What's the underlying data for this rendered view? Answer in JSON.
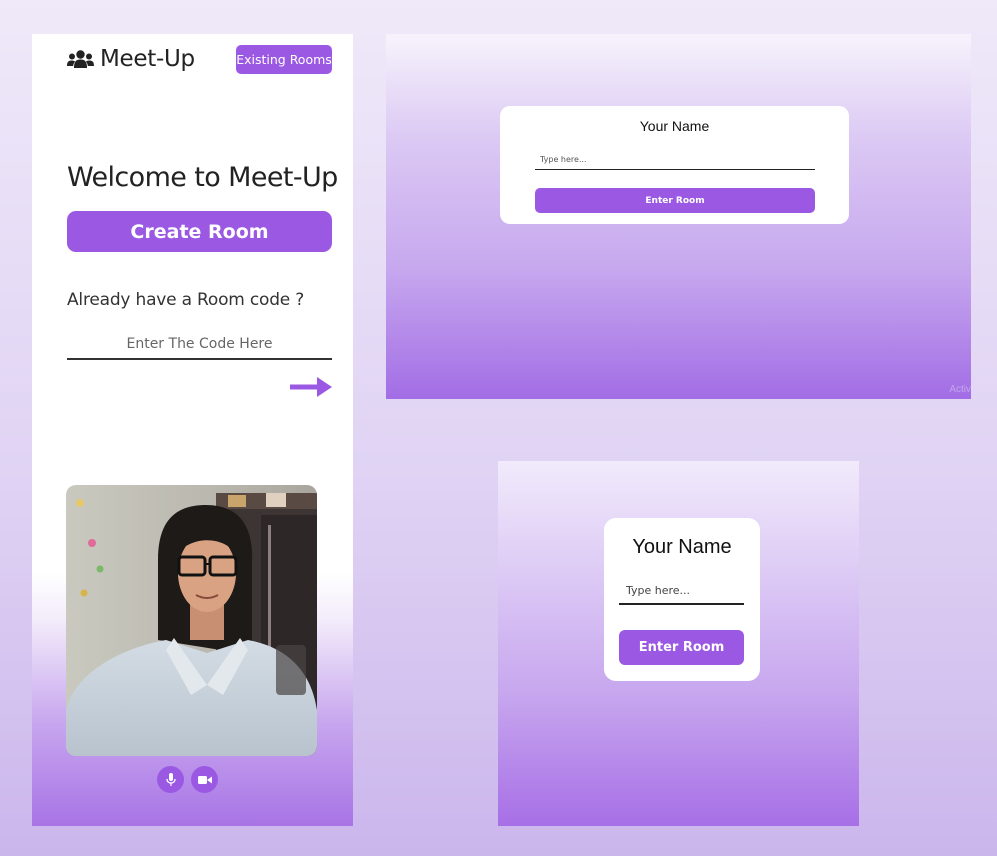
{
  "mobile": {
    "brand": {
      "icon": "users-icon",
      "name": "Meet-Up"
    },
    "existing_rooms_label": "Existing Rooms",
    "welcome_heading": "Welcome to Meet-Up",
    "create_room_label": "Create Room",
    "room_code_prompt": "Already have a Room code ?",
    "room_code_placeholder": "Enter The Code Here",
    "controls": {
      "mic_icon": "microphone-icon",
      "camera_icon": "video-camera-icon"
    }
  },
  "desktop": {
    "card": {
      "title": "Your Name",
      "name_placeholder": "Type here...",
      "enter_label": "Enter Room"
    },
    "watermark": "Activ"
  },
  "tablet": {
    "card": {
      "title": "Your Name",
      "name_placeholder": "Type here...",
      "enter_label": "Enter Room"
    }
  },
  "colors": {
    "accent": "#9b59e3",
    "text_dark": "#222222"
  }
}
